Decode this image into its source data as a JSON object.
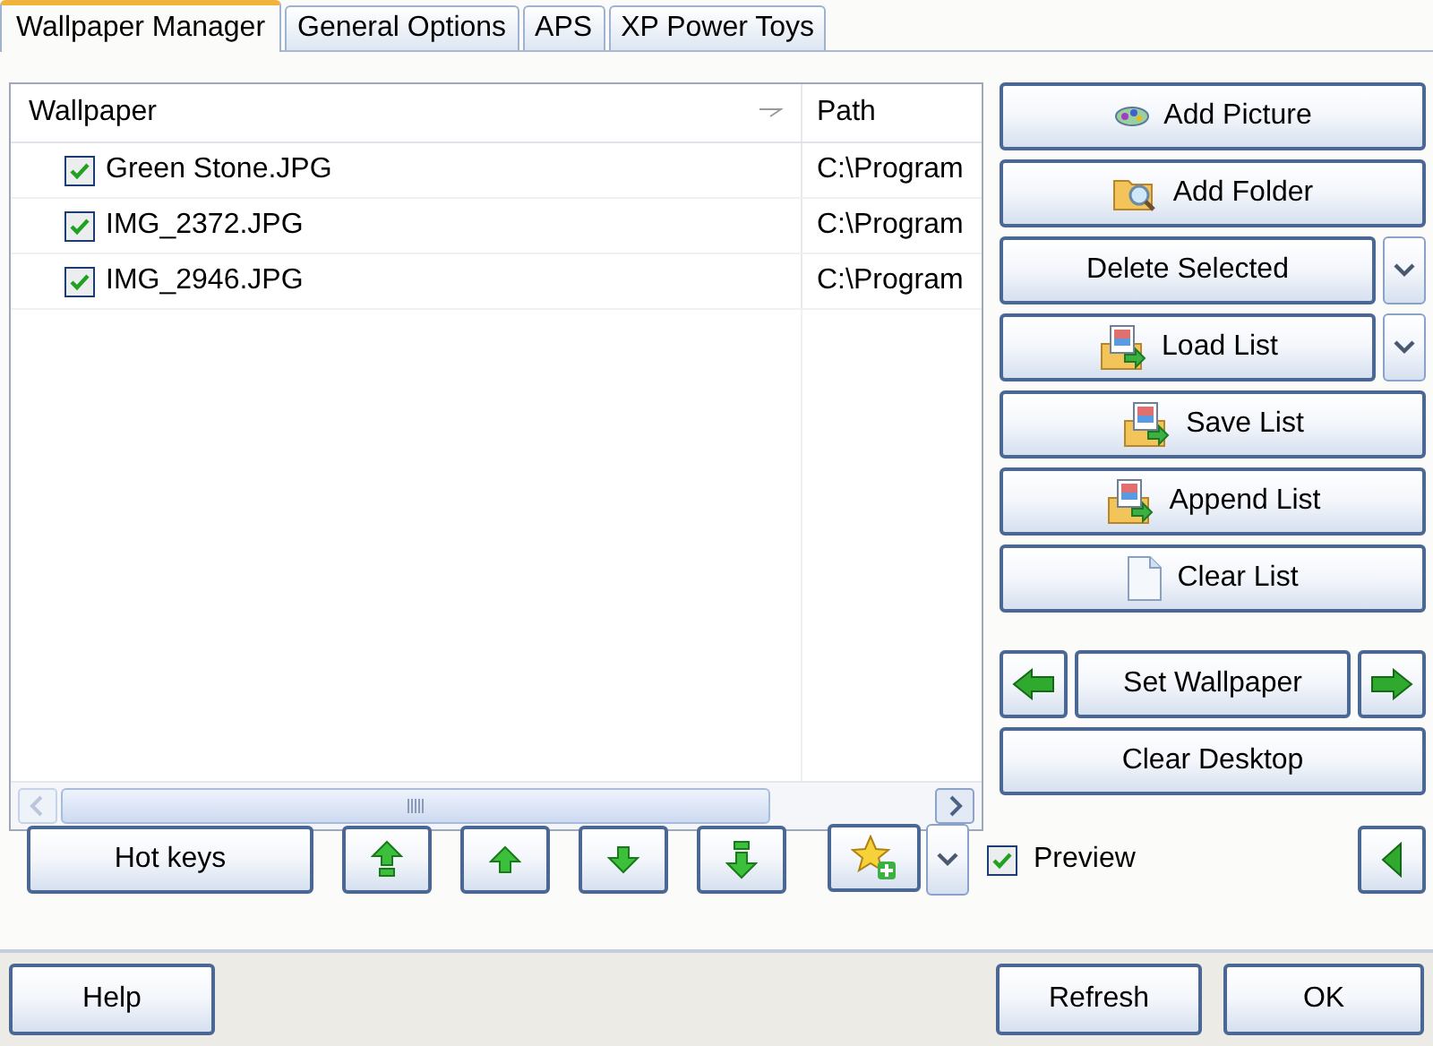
{
  "tabs": [
    {
      "label": "Wallpaper Manager",
      "selected": true
    },
    {
      "label": "General Options",
      "selected": false
    },
    {
      "label": "APS",
      "selected": false
    },
    {
      "label": "XP Power Toys",
      "selected": false
    }
  ],
  "list": {
    "columns": [
      "Wallpaper",
      "Path"
    ],
    "rows": [
      {
        "name": "Green Stone.JPG",
        "path": "C:\\Program",
        "checked": true
      },
      {
        "name": "IMG_2372.JPG",
        "path": "C:\\Program",
        "checked": true
      },
      {
        "name": "IMG_2946.JPG",
        "path": "C:\\Program",
        "checked": true
      }
    ]
  },
  "side_buttons": [
    {
      "label": "Add Picture",
      "kind": "plain"
    },
    {
      "label": "Add Folder",
      "kind": "plain"
    },
    {
      "label": "Delete Selected",
      "kind": "split"
    },
    {
      "label": "Load List",
      "kind": "split"
    },
    {
      "label": "Save List",
      "kind": "plain"
    },
    {
      "label": "Append List",
      "kind": "plain"
    },
    {
      "label": "Clear List",
      "kind": "plain"
    }
  ],
  "set_wallpaper": {
    "label": "Set Wallpaper"
  },
  "clear_desktop": {
    "label": "Clear Desktop"
  },
  "hot_keys": {
    "label": "Hot keys"
  },
  "preview": {
    "label": "Preview",
    "checked": true
  },
  "footer": {
    "help": "Help",
    "refresh": "Refresh",
    "ok": "OK"
  }
}
